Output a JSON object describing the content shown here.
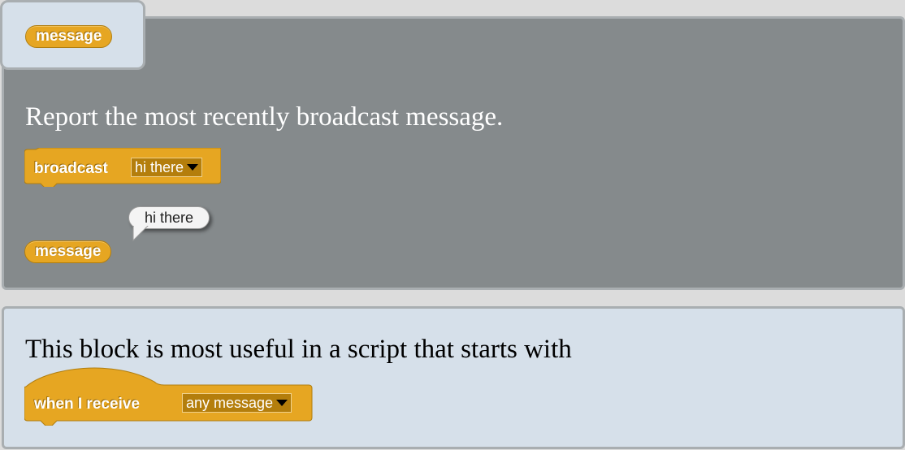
{
  "tab": {
    "block_label": "message"
  },
  "help": {
    "description": "Report the most recently broadcast message.",
    "broadcast_block": {
      "label": "broadcast",
      "dropdown_value": "hi there"
    },
    "speech_bubble": "hi there",
    "reporter_label": "message"
  },
  "usage": {
    "text": "This block is most useful in a script that starts with",
    "hat_block": {
      "label": "when I receive",
      "dropdown_value": "any message"
    }
  },
  "colors": {
    "block": "#e6a622",
    "panel_gray": "#858a8c",
    "panel_light": "#d6e0ea"
  }
}
